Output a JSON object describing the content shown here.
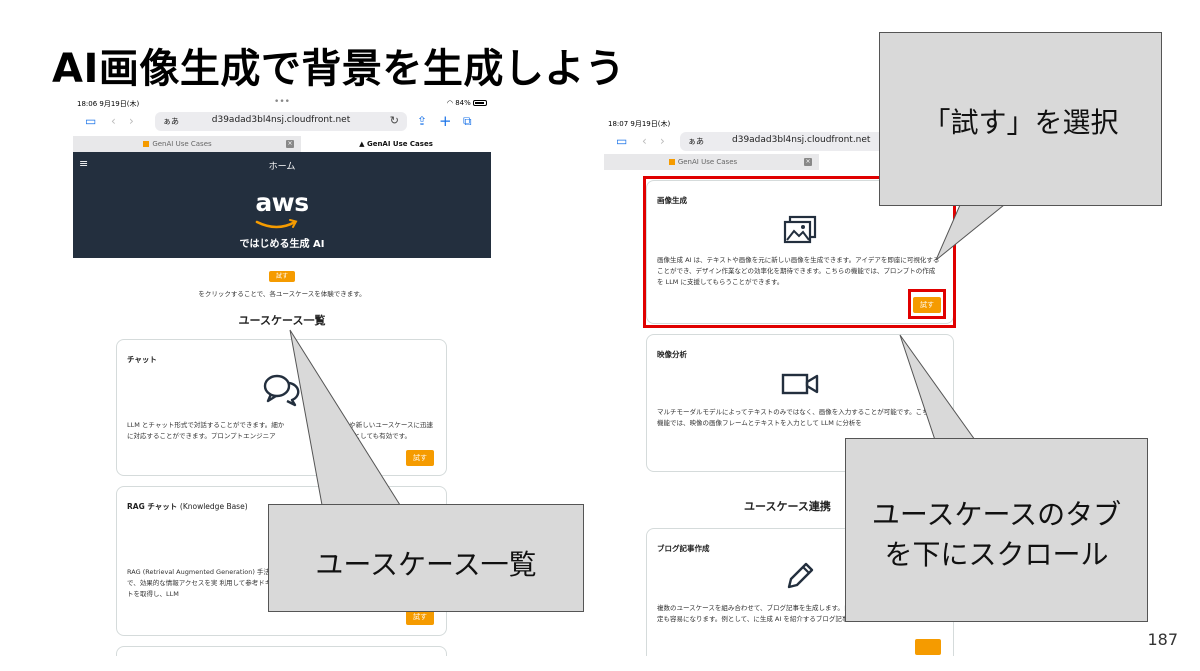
{
  "slide": {
    "title": "AI画像生成で背景を生成しよう",
    "page_number": "187"
  },
  "left_screen": {
    "status": {
      "time": "18:06  9月19日(木)",
      "battery": "84%"
    },
    "url": {
      "aa": "ぁあ",
      "host": "d39adad3bl4nsj.cloudfront.net"
    },
    "tabs": [
      "GenAI Use Cases",
      "GenAI Use Cases"
    ],
    "header": {
      "home": "ホーム",
      "logo": "aws",
      "subtitle": "ではじめる生成 AI"
    },
    "try_label": "試す",
    "hint": "をクリックすることで、各ユースケースを体験できます。",
    "section_title": "ユースケース一覧",
    "cards": [
      {
        "title": "チャット",
        "desc": "LLM とチャット形式で対話することができます。細か　　　　　　　　　　や新しいユースケースに迅速に対応することができます。プロンプトエンジニア　　　　　　　　　　環境としても有効です。",
        "button": "試す"
      },
      {
        "title": "RAG チャット",
        "title_sub": "(Knowledge Base)",
        "desc": "RAG (Retrieval Augmented Generation) 手法のことで、効果的な情報アクセスを実 利用して参考ドキュメントを取得し、LLM",
        "button": "試す"
      }
    ]
  },
  "right_screen": {
    "status": {
      "time": "18:07  9月19日(木)"
    },
    "url": {
      "aa": "ぁあ",
      "host": "d39adad3bl4nsj.cloudfront.net"
    },
    "tabs": [
      "GenAI Use Cases"
    ],
    "cards": [
      {
        "title": "画像生成",
        "desc": "画像生成 AI は、テキストや画像を元に新しい画像を生成できます。アイデアを即座に可視化することができ、デザイン作業などの効率化を期待できます。こちらの機能では、プロンプトの作成を LLM に支援してもらうことができます。",
        "button": "試す"
      },
      {
        "title": "映像分析",
        "desc": "マルチモーダルモデルによってテキストのみではなく、画像を入力することが可能です。こちらの機能では、映像の画像フレームとテキストを入力として LLM に分析を"
      },
      {
        "title": "ブログ記事作成",
        "desc": "複数のユースケースを組み合わせて、ブログ記事を生成します。自動生成することで、OGP の設定も容易になります。例として、に生成 AI を紹介するブログ記事を生成します。"
      }
    ],
    "section_title": "ユースケース連携"
  },
  "callouts": {
    "usecase_list": "ユースケース一覧",
    "select_try": "「試す」を選択",
    "scroll_tab_line1": "ユースケースのタブ",
    "scroll_tab_line2": "を下にスクロール"
  },
  "colors": {
    "accent": "#f59b00",
    "header": "#232f3e",
    "highlight": "#e00000",
    "callout": "#d9d9d9"
  }
}
